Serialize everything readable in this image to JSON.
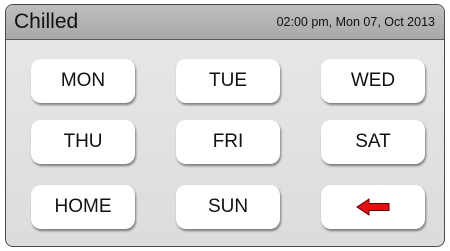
{
  "header": {
    "mode": "Chilled",
    "datetime": "02:00 pm, Mon 07, Oct 2013"
  },
  "buttons": {
    "mon": "MON",
    "tue": "TUE",
    "wed": "WED",
    "thu": "THU",
    "fri": "FRI",
    "sat": "SAT",
    "home": "HOME",
    "sun": "SUN",
    "back_icon": "left-arrow-icon"
  },
  "colors": {
    "arrow": "#e01010",
    "header": "#b3b3b3",
    "panel": "#e2e2e2"
  }
}
